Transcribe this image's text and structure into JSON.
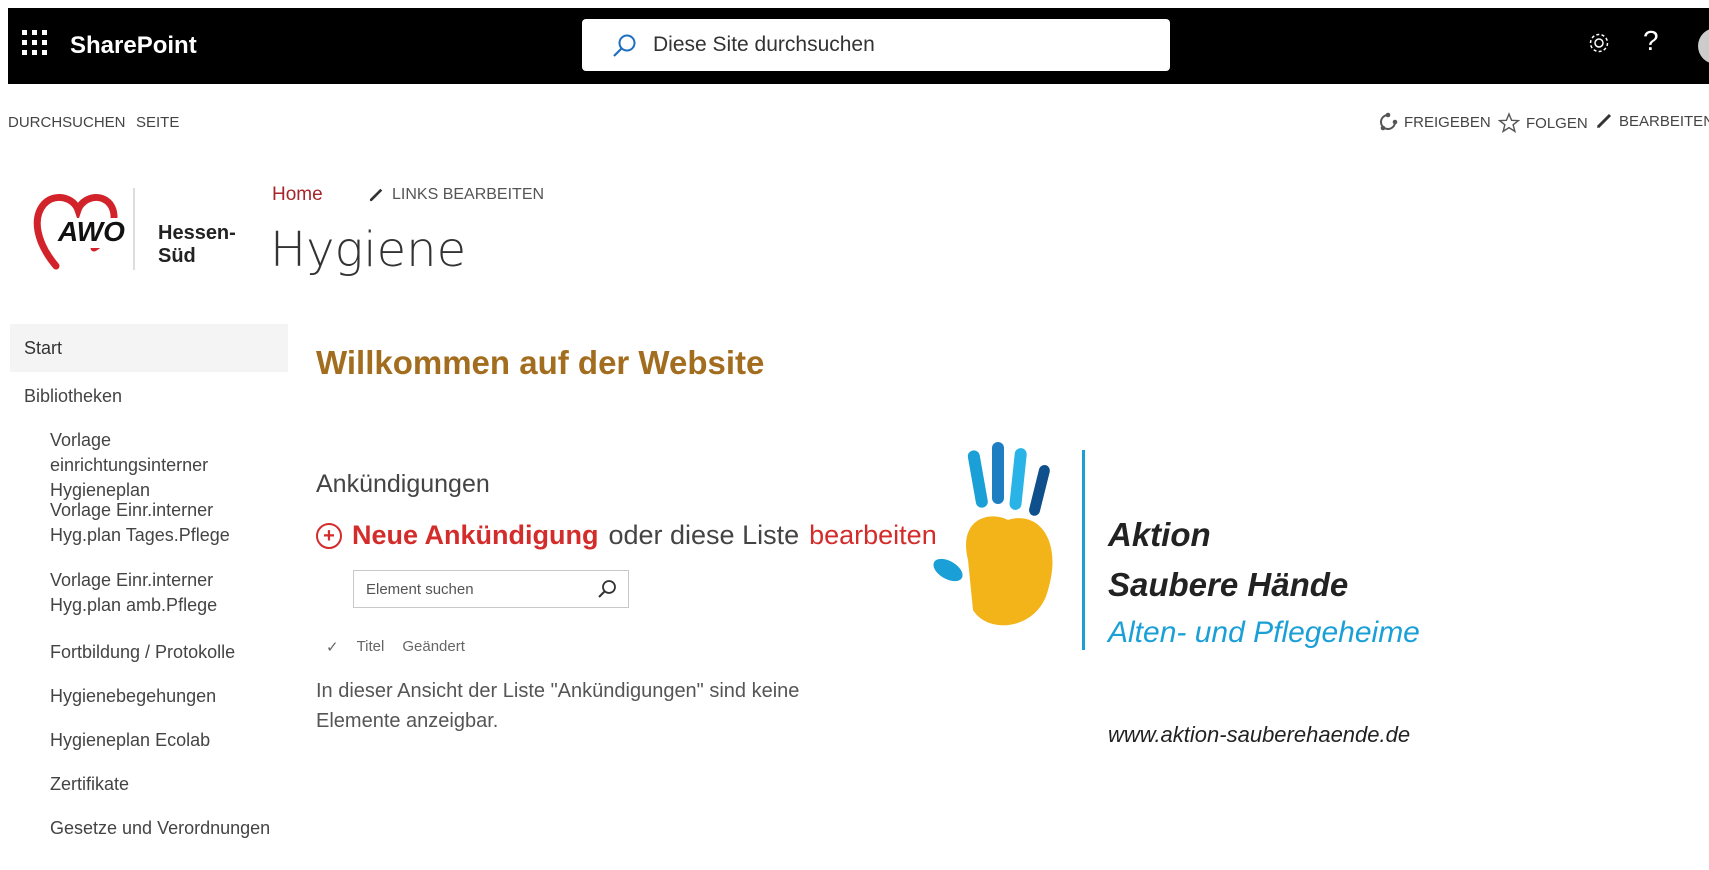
{
  "suitebar": {
    "app_name": "SharePoint",
    "search_placeholder": "Diese Site durchsuchen",
    "help_label": "?"
  },
  "ribbon": {
    "tabs": [
      "DURCHSUCHEN",
      "SEITE"
    ],
    "actions": {
      "share": "FREIGEBEN",
      "follow": "FOLGEN",
      "edit": "BEARBEITEN"
    }
  },
  "header": {
    "logo": {
      "brand": "AWO",
      "region": "Hessen-Süd"
    },
    "breadcrumb_home": "Home",
    "edit_links": "LINKS BEARBEITEN",
    "site_title": "Hygiene"
  },
  "nav": {
    "start": "Start",
    "section": "Bibliotheken",
    "items": [
      "Vorlage einrichtungsinterner Hygieneplan",
      "Vorlage Einr.interner Hyg.plan Tages.Pflege",
      "Vorlage Einr.interner Hyg.plan amb.Pflege",
      "Fortbildung / Protokolle",
      "Hygienebegehungen",
      "Hygieneplan Ecolab",
      "Zertifikate",
      "Gesetze und Verordnungen"
    ]
  },
  "main": {
    "welcome": "Willkommen auf der Website",
    "announcements": {
      "title": "Ankündigungen",
      "new_link": "Neue Ankündigung",
      "middle_text": "oder diese Liste",
      "edit_link": "bearbeiten",
      "search_placeholder": "Element suchen",
      "columns": [
        "Titel",
        "Geändert"
      ],
      "empty_message": "In dieser Ansicht der Liste \"Ankündigungen\" sind keine Elemente anzeigbar."
    },
    "campaign": {
      "line1": "Aktion",
      "line2": "Saubere Hände",
      "line3": "Alten- und Pflegeheime",
      "url": "www.aktion-sauberehaende.de"
    }
  },
  "colors": {
    "suitebar": "#000000",
    "accent_red": "#d42b2b",
    "welcome": "#a26d1f",
    "campaign_blue": "#1aa0d6"
  }
}
